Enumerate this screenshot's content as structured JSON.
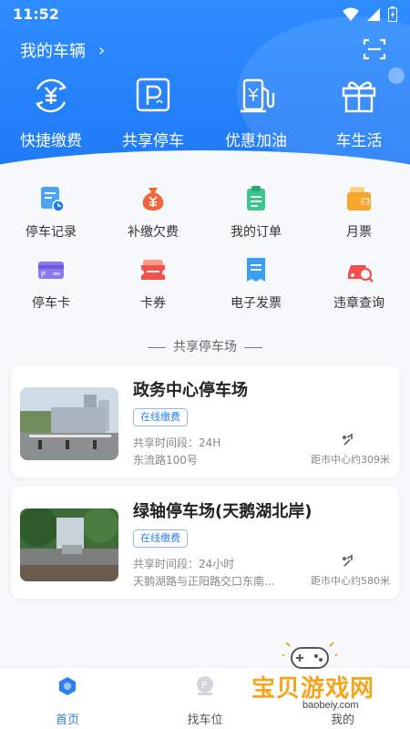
{
  "status": {
    "time": "11:52"
  },
  "header": {
    "vehicle_title": "我的车辆",
    "chevron": "›"
  },
  "quick_actions": [
    {
      "label": "快捷缴费",
      "icon": "yuan-refresh-icon"
    },
    {
      "label": "共享停车",
      "icon": "parking-icon"
    },
    {
      "label": "优惠加油",
      "icon": "fuel-pump-icon"
    },
    {
      "label": "车生活",
      "icon": "gift-icon"
    }
  ],
  "grid": [
    {
      "label": "停车记录",
      "icon": "parking-record-icon"
    },
    {
      "label": "补缴欠费",
      "icon": "money-bag-icon"
    },
    {
      "label": "我的订单",
      "icon": "order-icon"
    },
    {
      "label": "月票",
      "icon": "monthly-ticket-icon"
    },
    {
      "label": "停车卡",
      "icon": "parking-card-icon"
    },
    {
      "label": "卡券",
      "icon": "coupon-icon"
    },
    {
      "label": "电子发票",
      "icon": "invoice-icon"
    },
    {
      "label": "违章查询",
      "icon": "violation-search-icon"
    }
  ],
  "section_title": "共享停车场",
  "lots": [
    {
      "name": "政务中心停车场",
      "badge": "在线缴费",
      "time": "共享时间段：24H",
      "address": "东流路100号",
      "distance": "距市中心约309米"
    },
    {
      "name": "绿轴停车场(天鹅湖北岸)",
      "badge": "在线缴费",
      "time": "共享时间段：24小时",
      "address": "天鹅湖路与正阳路交口东南...",
      "distance": "距市中心约580米"
    }
  ],
  "tabs": [
    {
      "label": "首页",
      "active": true
    },
    {
      "label": "找车位",
      "active": false
    },
    {
      "label": "我的",
      "active": false
    }
  ],
  "watermark": {
    "text": "宝贝游戏网",
    "url": "baobeiy.com"
  },
  "colors": {
    "primary": "#2f80ed",
    "hero": "#1f7af5"
  }
}
